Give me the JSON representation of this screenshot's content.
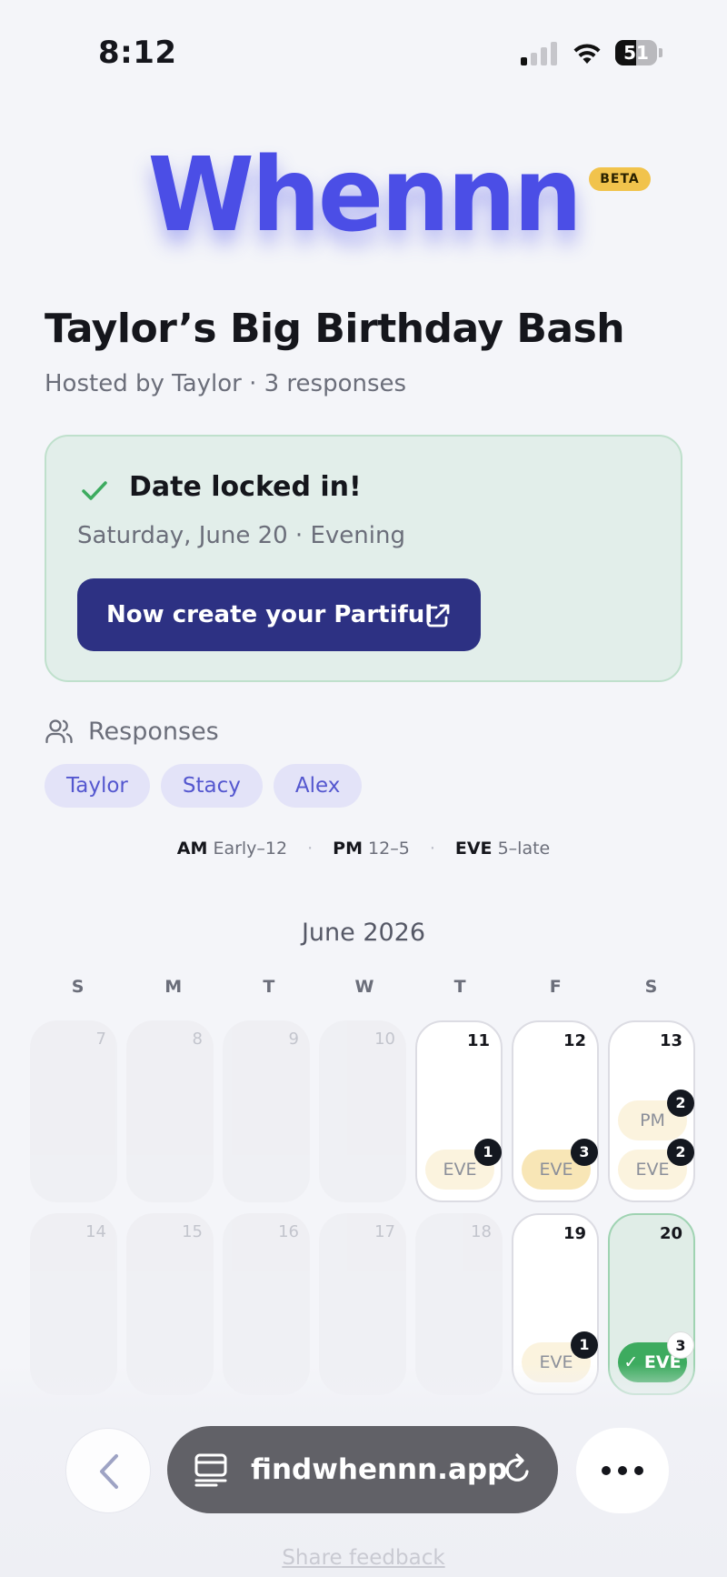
{
  "status_bar": {
    "time": "8:12",
    "battery": "51",
    "battery_level": 0.51,
    "signal_bars_active": 1,
    "signal_bars_total": 4
  },
  "logo": {
    "text": "Whennn",
    "badge": "BETA",
    "color": "#4b4ee6"
  },
  "event": {
    "title": "Taylor’s Big Birthday Bash",
    "meta": "Hosted by Taylor · 3 responses"
  },
  "locked": {
    "icon": "check-icon",
    "title": "Date locked in!",
    "date": "Saturday, June 20 · Evening",
    "cta_label": "Now create your Partiful",
    "cta_icon": "external-link-icon"
  },
  "responses": {
    "label": "Responses",
    "icon": "users-icon",
    "people": [
      "Taylor",
      "Stacy",
      "Alex"
    ]
  },
  "legend": [
    {
      "key": "AM",
      "range": "Early–12"
    },
    {
      "key": "PM",
      "range": "12–5"
    },
    {
      "key": "EVE",
      "range": "5–late"
    }
  ],
  "calendar": {
    "month": "June 2026",
    "weekdays": [
      "S",
      "M",
      "T",
      "W",
      "T",
      "F",
      "S"
    ],
    "weeks": [
      [
        {
          "day": "7",
          "state": "inactive",
          "slots": []
        },
        {
          "day": "8",
          "state": "inactive",
          "slots": []
        },
        {
          "day": "9",
          "state": "inactive",
          "slots": []
        },
        {
          "day": "10",
          "state": "inactive",
          "slots": []
        },
        {
          "day": "11",
          "state": "active",
          "slots": [
            {
              "label": "EVE",
              "count": "1",
              "style": "light"
            }
          ]
        },
        {
          "day": "12",
          "state": "active",
          "slots": [
            {
              "label": "EVE",
              "count": "3",
              "style": "full"
            }
          ]
        },
        {
          "day": "13",
          "state": "active",
          "slots": [
            {
              "label": "PM",
              "count": "2",
              "style": "light"
            },
            {
              "label": "EVE",
              "count": "2",
              "style": "light"
            }
          ]
        }
      ],
      [
        {
          "day": "14",
          "state": "inactive",
          "slots": []
        },
        {
          "day": "15",
          "state": "inactive",
          "slots": []
        },
        {
          "day": "16",
          "state": "inactive",
          "slots": []
        },
        {
          "day": "17",
          "state": "inactive",
          "slots": []
        },
        {
          "day": "18",
          "state": "inactive",
          "slots": []
        },
        {
          "day": "19",
          "state": "active",
          "slots": [
            {
              "label": "EVE",
              "count": "1",
              "style": "light"
            }
          ]
        },
        {
          "day": "20",
          "state": "locked",
          "slots": [
            {
              "label": "✓ EVE",
              "count": "3",
              "style": "chosen"
            }
          ]
        }
      ]
    ]
  },
  "browser": {
    "url": "findwhennn.app",
    "back_icon": "back-chevron-icon",
    "tabs_icon": "tabs-icon",
    "reload_icon": "reload-icon",
    "more_icon": "more-icon"
  },
  "footer": {
    "share_feedback": "Share feedback"
  },
  "colors": {
    "accent": "#4b4ee6",
    "button_dark": "#2d3183",
    "locked_green": "#3dab5f",
    "chip_bg": "#e3e3f8",
    "beta": "#f1c34c"
  }
}
